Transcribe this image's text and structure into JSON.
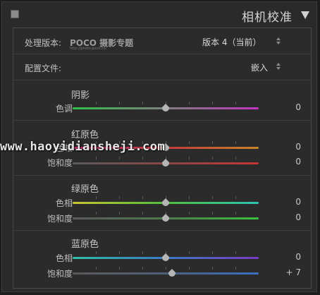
{
  "header": {
    "title": "相机校准"
  },
  "process": {
    "label": "处理版本:",
    "logo_main": "POCO 摄影专题",
    "logo_sub": "http://photo.poco.cn/",
    "value": "版本 4（当前）"
  },
  "profile": {
    "label": "配置文件:",
    "value": "嵌入"
  },
  "shadow": {
    "title": "阴影",
    "tint_label": "色调",
    "tint_value": "0",
    "tint_level": 0
  },
  "red": {
    "title": "红原色",
    "hue_label": "色相",
    "hue_value": "0",
    "hue_level": 0,
    "sat_label": "饱和度",
    "sat_value": "0",
    "sat_level": 0
  },
  "green": {
    "title": "绿原色",
    "hue_label": "色相",
    "hue_value": "0",
    "hue_level": 0,
    "sat_label": "饱和度",
    "sat_value": "0",
    "sat_level": 0
  },
  "blue": {
    "title": "蓝原色",
    "hue_label": "色相",
    "hue_value": "0",
    "hue_level": 0,
    "sat_label": "饱和度",
    "sat_value": "+ 7",
    "sat_level": 7
  },
  "watermark": "www.haoyidiansheji.com",
  "colors": {
    "panel_bg": "#2b2b2b",
    "text": "#c8c8c8"
  }
}
